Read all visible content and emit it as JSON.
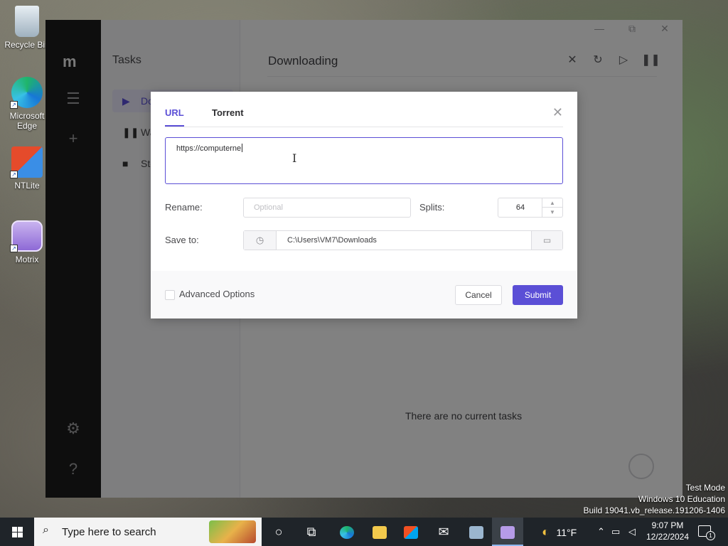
{
  "desktop": {
    "icons": [
      {
        "label": "Recycle Bin",
        "icon": "recycle-bin-icon"
      },
      {
        "label": "Microsoft Edge",
        "icon": "edge-icon"
      },
      {
        "label": "NTLite",
        "icon": "ntlite-icon"
      },
      {
        "label": "Motrix",
        "icon": "motrix-icon"
      }
    ],
    "watermark": [
      "Test Mode",
      "Windows 10 Education",
      "Build 19041.vb_release.191206-1406"
    ]
  },
  "app": {
    "name": "Motrix",
    "sidebar_title": "Tasks",
    "nav": [
      {
        "label": "Downloading",
        "icon": "play-icon",
        "active": true
      },
      {
        "label": "Waiting",
        "icon": "pause-icon",
        "active": false
      },
      {
        "label": "Stopped",
        "icon": "stop-icon",
        "active": false
      }
    ],
    "header_title": "Downloading",
    "empty_text": "There are no current tasks",
    "accent_color": "#5b4fd6"
  },
  "dialog": {
    "tabs": [
      {
        "label": "URL",
        "active": true
      },
      {
        "label": "Torrent",
        "active": false
      }
    ],
    "url_value": "https://computerne",
    "rename_label": "Rename:",
    "rename_placeholder": "Optional",
    "splits_label": "Splits:",
    "splits_value": "64",
    "save_to_label": "Save to:",
    "save_path": "C:\\Users\\VM7\\Downloads",
    "advanced_options_label": "Advanced Options",
    "cancel_label": "Cancel",
    "submit_label": "Submit"
  },
  "taskbar": {
    "search_placeholder": "Type here to search",
    "weather": "11°F",
    "time": "9:07 PM",
    "date": "12/22/2024",
    "notification_count": "1"
  }
}
